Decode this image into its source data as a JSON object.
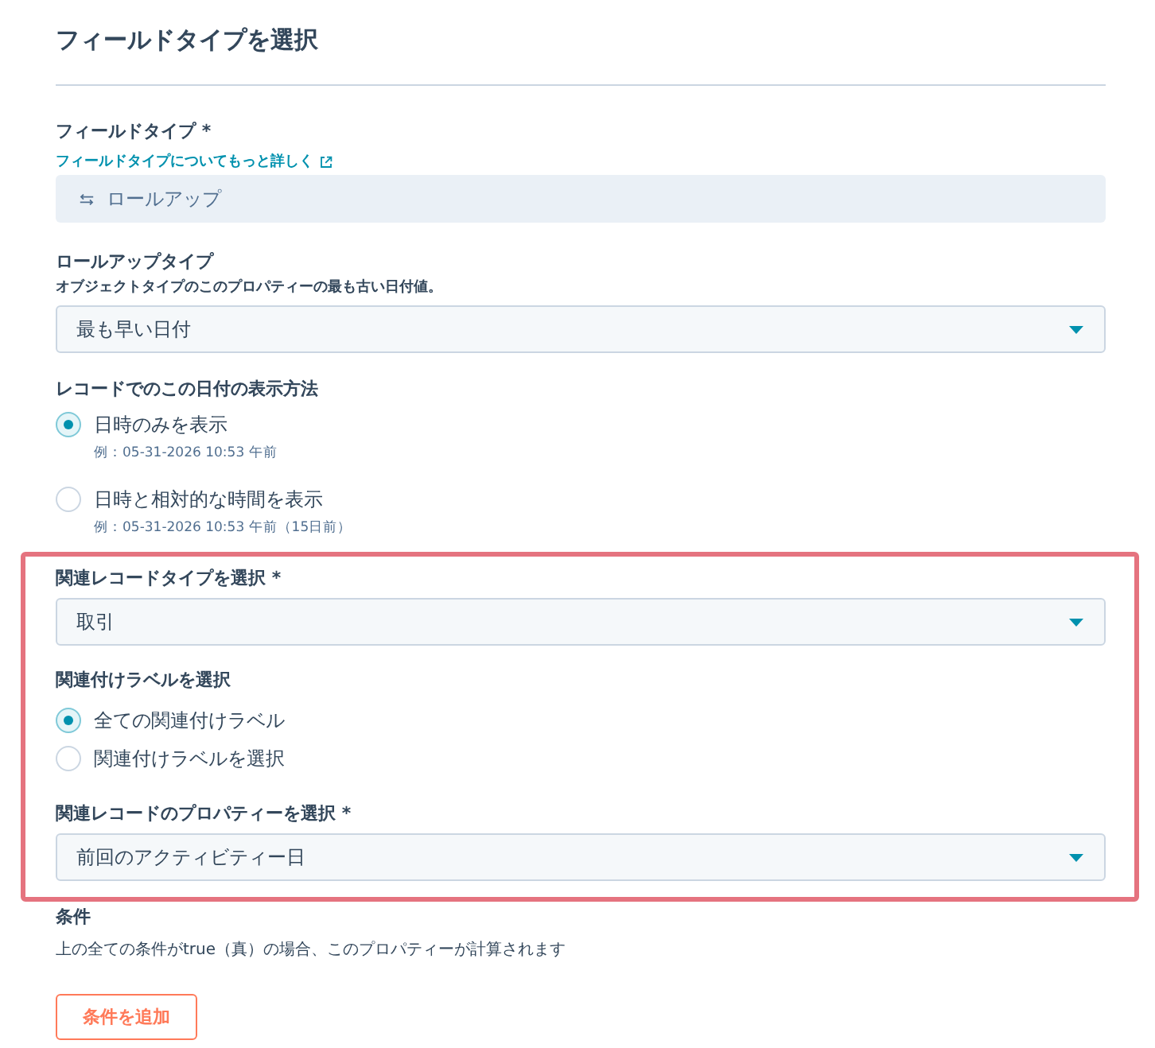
{
  "title": "フィールドタイプを選択",
  "field_type": {
    "label": "フィールドタイプ *",
    "link": "フィールドタイプについてもっと詳しく",
    "value": "ロールアップ",
    "disabled": true
  },
  "rollup_type": {
    "label": "ロールアップタイプ",
    "help": "オブジェクトタイプのこのプロパティーの最も古い日付値。",
    "value": "最も早い日付"
  },
  "display_format": {
    "label": "レコードでのこの日付の表示方法",
    "options": [
      {
        "label": "日時のみを表示",
        "example": "例：05-31-2026 10:53 午前",
        "selected": true
      },
      {
        "label": "日時と相対的な時間を表示",
        "example": "例：05-31-2026 10:53 午前（15日前）",
        "selected": false
      }
    ]
  },
  "association": {
    "highlighted": true,
    "record_type": {
      "label": "関連レコードタイプを選択 *",
      "value": "取引"
    },
    "association_label": {
      "label": "関連付けラベルを選択",
      "options": [
        {
          "label": "全ての関連付けラベル",
          "selected": true
        },
        {
          "label": "関連付けラベルを選択",
          "selected": false
        }
      ]
    },
    "property": {
      "label": "関連レコードのプロパティーを選択 *",
      "value": "前回のアクティビティー日"
    }
  },
  "conditions": {
    "label": "条件",
    "description": "上の全ての条件がtrue（真）の場合、このプロパティーが計算されます",
    "button": "条件を追加"
  }
}
